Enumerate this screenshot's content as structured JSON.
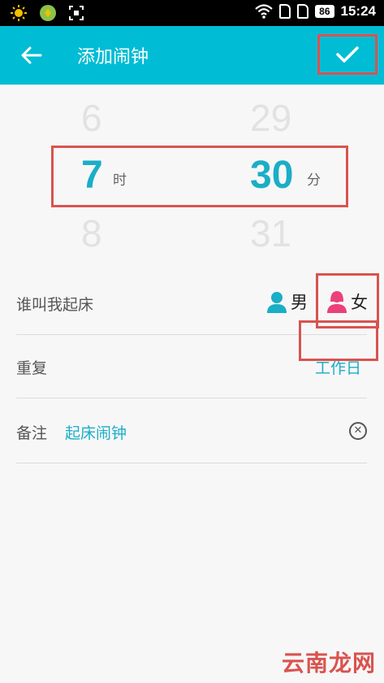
{
  "status_bar": {
    "battery": "86",
    "time": "15:24"
  },
  "app_bar": {
    "title": "添加闹钟"
  },
  "picker": {
    "hour": {
      "prev": "6",
      "selected": "7",
      "next": "8",
      "unit": "时"
    },
    "minute": {
      "prev": "29",
      "selected": "30",
      "next": "31",
      "unit": "分"
    }
  },
  "wake_by": {
    "label": "谁叫我起床",
    "options": [
      "男",
      "女"
    ],
    "selected": "女"
  },
  "repeat": {
    "label": "重复",
    "value": "工作日"
  },
  "note": {
    "label": "备注",
    "value": "起床闹钟"
  },
  "watermark": "云南龙网",
  "colors": {
    "accent": "#00bcd4",
    "accent_text": "#1aaec7",
    "highlight": "#d9534f",
    "male_icon": "#1aaec7",
    "female_icon": "#ec407a"
  }
}
